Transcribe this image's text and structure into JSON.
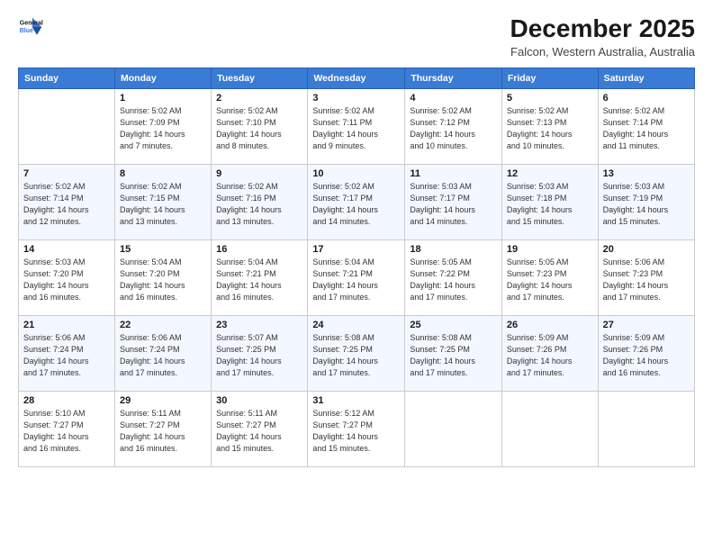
{
  "header": {
    "logo_line1": "General",
    "logo_line2": "Blue",
    "title": "December 2025",
    "subtitle": "Falcon, Western Australia, Australia"
  },
  "days": [
    "Sunday",
    "Monday",
    "Tuesday",
    "Wednesday",
    "Thursday",
    "Friday",
    "Saturday"
  ],
  "weeks": [
    [
      {
        "num": "",
        "info": ""
      },
      {
        "num": "1",
        "info": "Sunrise: 5:02 AM\nSunset: 7:09 PM\nDaylight: 14 hours\nand 7 minutes."
      },
      {
        "num": "2",
        "info": "Sunrise: 5:02 AM\nSunset: 7:10 PM\nDaylight: 14 hours\nand 8 minutes."
      },
      {
        "num": "3",
        "info": "Sunrise: 5:02 AM\nSunset: 7:11 PM\nDaylight: 14 hours\nand 9 minutes."
      },
      {
        "num": "4",
        "info": "Sunrise: 5:02 AM\nSunset: 7:12 PM\nDaylight: 14 hours\nand 10 minutes."
      },
      {
        "num": "5",
        "info": "Sunrise: 5:02 AM\nSunset: 7:13 PM\nDaylight: 14 hours\nand 10 minutes."
      },
      {
        "num": "6",
        "info": "Sunrise: 5:02 AM\nSunset: 7:14 PM\nDaylight: 14 hours\nand 11 minutes."
      }
    ],
    [
      {
        "num": "7",
        "info": "Sunrise: 5:02 AM\nSunset: 7:14 PM\nDaylight: 14 hours\nand 12 minutes."
      },
      {
        "num": "8",
        "info": "Sunrise: 5:02 AM\nSunset: 7:15 PM\nDaylight: 14 hours\nand 13 minutes."
      },
      {
        "num": "9",
        "info": "Sunrise: 5:02 AM\nSunset: 7:16 PM\nDaylight: 14 hours\nand 13 minutes."
      },
      {
        "num": "10",
        "info": "Sunrise: 5:02 AM\nSunset: 7:17 PM\nDaylight: 14 hours\nand 14 minutes."
      },
      {
        "num": "11",
        "info": "Sunrise: 5:03 AM\nSunset: 7:17 PM\nDaylight: 14 hours\nand 14 minutes."
      },
      {
        "num": "12",
        "info": "Sunrise: 5:03 AM\nSunset: 7:18 PM\nDaylight: 14 hours\nand 15 minutes."
      },
      {
        "num": "13",
        "info": "Sunrise: 5:03 AM\nSunset: 7:19 PM\nDaylight: 14 hours\nand 15 minutes."
      }
    ],
    [
      {
        "num": "14",
        "info": "Sunrise: 5:03 AM\nSunset: 7:20 PM\nDaylight: 14 hours\nand 16 minutes."
      },
      {
        "num": "15",
        "info": "Sunrise: 5:04 AM\nSunset: 7:20 PM\nDaylight: 14 hours\nand 16 minutes."
      },
      {
        "num": "16",
        "info": "Sunrise: 5:04 AM\nSunset: 7:21 PM\nDaylight: 14 hours\nand 16 minutes."
      },
      {
        "num": "17",
        "info": "Sunrise: 5:04 AM\nSunset: 7:21 PM\nDaylight: 14 hours\nand 17 minutes."
      },
      {
        "num": "18",
        "info": "Sunrise: 5:05 AM\nSunset: 7:22 PM\nDaylight: 14 hours\nand 17 minutes."
      },
      {
        "num": "19",
        "info": "Sunrise: 5:05 AM\nSunset: 7:23 PM\nDaylight: 14 hours\nand 17 minutes."
      },
      {
        "num": "20",
        "info": "Sunrise: 5:06 AM\nSunset: 7:23 PM\nDaylight: 14 hours\nand 17 minutes."
      }
    ],
    [
      {
        "num": "21",
        "info": "Sunrise: 5:06 AM\nSunset: 7:24 PM\nDaylight: 14 hours\nand 17 minutes."
      },
      {
        "num": "22",
        "info": "Sunrise: 5:06 AM\nSunset: 7:24 PM\nDaylight: 14 hours\nand 17 minutes."
      },
      {
        "num": "23",
        "info": "Sunrise: 5:07 AM\nSunset: 7:25 PM\nDaylight: 14 hours\nand 17 minutes."
      },
      {
        "num": "24",
        "info": "Sunrise: 5:08 AM\nSunset: 7:25 PM\nDaylight: 14 hours\nand 17 minutes."
      },
      {
        "num": "25",
        "info": "Sunrise: 5:08 AM\nSunset: 7:25 PM\nDaylight: 14 hours\nand 17 minutes."
      },
      {
        "num": "26",
        "info": "Sunrise: 5:09 AM\nSunset: 7:26 PM\nDaylight: 14 hours\nand 17 minutes."
      },
      {
        "num": "27",
        "info": "Sunrise: 5:09 AM\nSunset: 7:26 PM\nDaylight: 14 hours\nand 16 minutes."
      }
    ],
    [
      {
        "num": "28",
        "info": "Sunrise: 5:10 AM\nSunset: 7:27 PM\nDaylight: 14 hours\nand 16 minutes."
      },
      {
        "num": "29",
        "info": "Sunrise: 5:11 AM\nSunset: 7:27 PM\nDaylight: 14 hours\nand 16 minutes."
      },
      {
        "num": "30",
        "info": "Sunrise: 5:11 AM\nSunset: 7:27 PM\nDaylight: 14 hours\nand 15 minutes."
      },
      {
        "num": "31",
        "info": "Sunrise: 5:12 AM\nSunset: 7:27 PM\nDaylight: 14 hours\nand 15 minutes."
      },
      {
        "num": "",
        "info": ""
      },
      {
        "num": "",
        "info": ""
      },
      {
        "num": "",
        "info": ""
      }
    ]
  ]
}
